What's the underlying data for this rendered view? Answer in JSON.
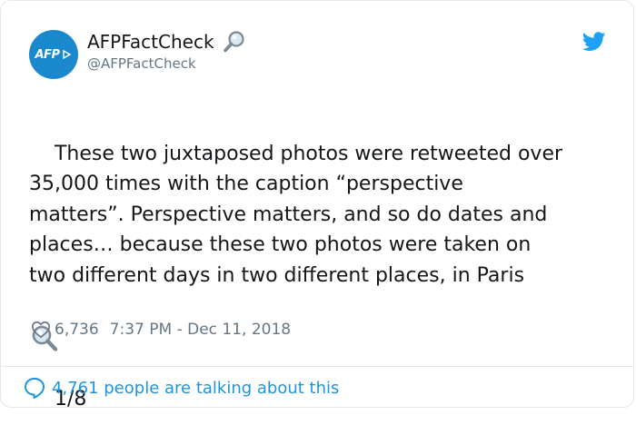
{
  "colors": {
    "avatar_bg": "#1a88cc",
    "text_primary": "#14171a",
    "text_secondary": "#657786",
    "link_blue": "#1b95e0",
    "twitter_blue": "#1da1f2",
    "border": "#e1e8ed"
  },
  "author": {
    "avatar_label": "AFP",
    "display_name": "AFPFactCheck",
    "name_emoji": "magnifier-icon",
    "handle": "@AFPFactCheck"
  },
  "header": {
    "brand_icon": "twitter-bird-icon"
  },
  "tweet": {
    "text": "These two juxtaposed photos were retweeted over\n35,000 times with the caption “perspective\nmatters”. Perspective matters, and so do dates and\nplaces… because these two photos were taken on\ntwo different days in two different places, in Paris",
    "inline_emoji": "magnifier-icon",
    "thread_counter": "1/8"
  },
  "meta": {
    "like_icon": "heart-icon",
    "likes": "6,736",
    "timestamp": "7:37 PM - Dec 11, 2018"
  },
  "footer": {
    "icon": "speech-bubble-icon",
    "label": "4,761 people are talking about this"
  }
}
